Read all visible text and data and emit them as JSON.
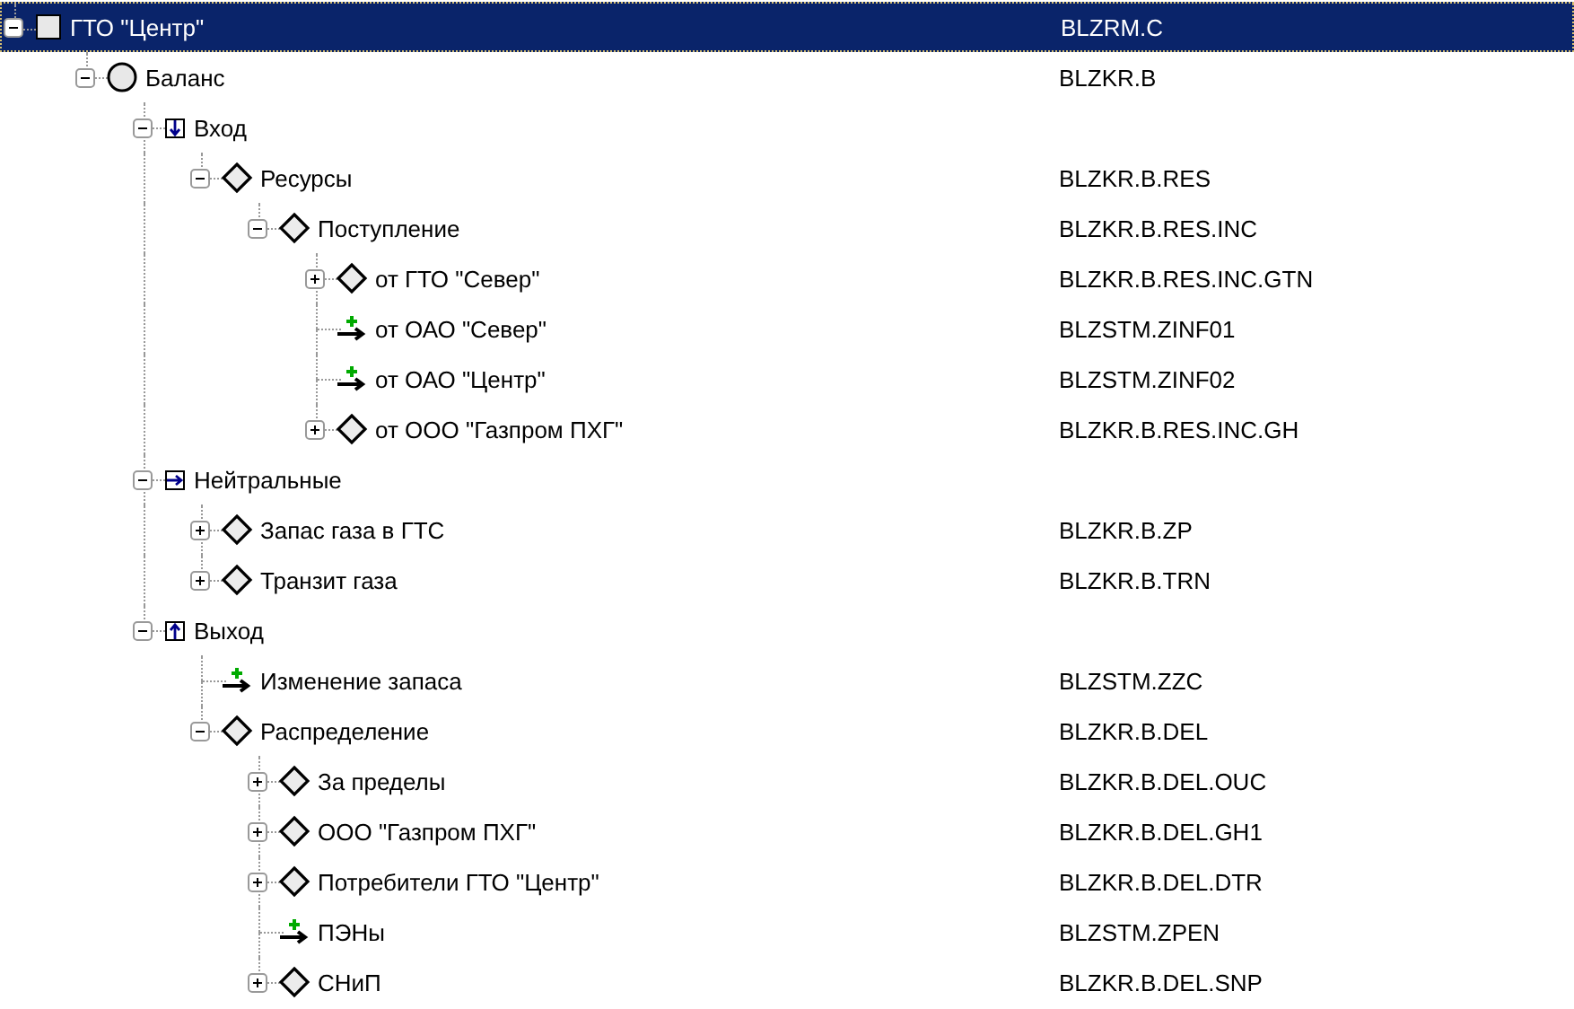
{
  "tree": [
    {
      "label": "ГТО \"Центр\"",
      "code": "BLZRM.C",
      "kind": "square",
      "expanded": true,
      "selected": true,
      "children": [
        {
          "label": "Баланс",
          "code": "BLZKR.B",
          "kind": "circle",
          "expanded": true,
          "selected": false,
          "children": [
            {
              "label": "Вход",
              "kind": "in",
              "expanded": true,
              "selected": false,
              "children": [
                {
                  "label": "Ресурсы",
                  "code": "BLZKR.B.RES",
                  "kind": "diamond",
                  "expanded": true,
                  "selected": false,
                  "children": [
                    {
                      "label": "Поступление",
                      "code": "BLZKR.B.RES.INC",
                      "kind": "diamond",
                      "expanded": true,
                      "selected": false,
                      "children": [
                        {
                          "label": "от ГТО \"Север\"",
                          "code": "BLZKR.B.RES.INC.GTN",
                          "kind": "diamond",
                          "expanded": false,
                          "selected": false
                        },
                        {
                          "label": "от ОАО \"Север\"",
                          "code": "BLZSTM.ZINF01",
                          "kind": "flow",
                          "selected": false
                        },
                        {
                          "label": "от ОАО \"Центр\"",
                          "code": "BLZSTM.ZINF02",
                          "kind": "flow",
                          "selected": false
                        },
                        {
                          "label": "от ООО \"Газпром ПХГ\"",
                          "code": "BLZKR.B.RES.INC.GH",
                          "kind": "diamond",
                          "expanded": false,
                          "selected": false
                        }
                      ]
                    }
                  ]
                }
              ]
            },
            {
              "label": "Нейтральные",
              "kind": "neutral",
              "expanded": true,
              "selected": false,
              "children": [
                {
                  "label": "Запас газа в ГТС",
                  "code": "BLZKR.B.ZP",
                  "kind": "diamond",
                  "expanded": false,
                  "selected": false
                },
                {
                  "label": "Транзит газа",
                  "code": "BLZKR.B.TRN",
                  "kind": "diamond",
                  "expanded": false,
                  "selected": false
                }
              ]
            },
            {
              "label": "Выход",
              "kind": "out",
              "expanded": true,
              "selected": false,
              "children": [
                {
                  "label": "Изменение запаса",
                  "code": "BLZSTM.ZZC",
                  "kind": "flow",
                  "selected": false
                },
                {
                  "label": "Распределение",
                  "code": "BLZKR.B.DEL",
                  "kind": "diamond",
                  "expanded": true,
                  "selected": false,
                  "children": [
                    {
                      "label": "За пределы",
                      "code": "BLZKR.B.DEL.OUC",
                      "kind": "diamond",
                      "expanded": false,
                      "selected": false
                    },
                    {
                      "label": "ООО \"Газпром ПХГ\"",
                      "code": "BLZKR.B.DEL.GH1",
                      "kind": "diamond",
                      "expanded": false,
                      "selected": false
                    },
                    {
                      "label": "Потребители ГТО \"Центр\"",
                      "code": "BLZKR.B.DEL.DTR",
                      "kind": "diamond",
                      "expanded": false,
                      "selected": false
                    },
                    {
                      "label": "ПЭНы",
                      "code": "BLZSTM.ZPEN",
                      "kind": "flow",
                      "selected": false
                    },
                    {
                      "label": "СНиП",
                      "code": "BLZKR.B.DEL.SNP",
                      "kind": "diamond",
                      "expanded": false,
                      "selected": false
                    }
                  ]
                }
              ]
            }
          ]
        }
      ]
    }
  ]
}
